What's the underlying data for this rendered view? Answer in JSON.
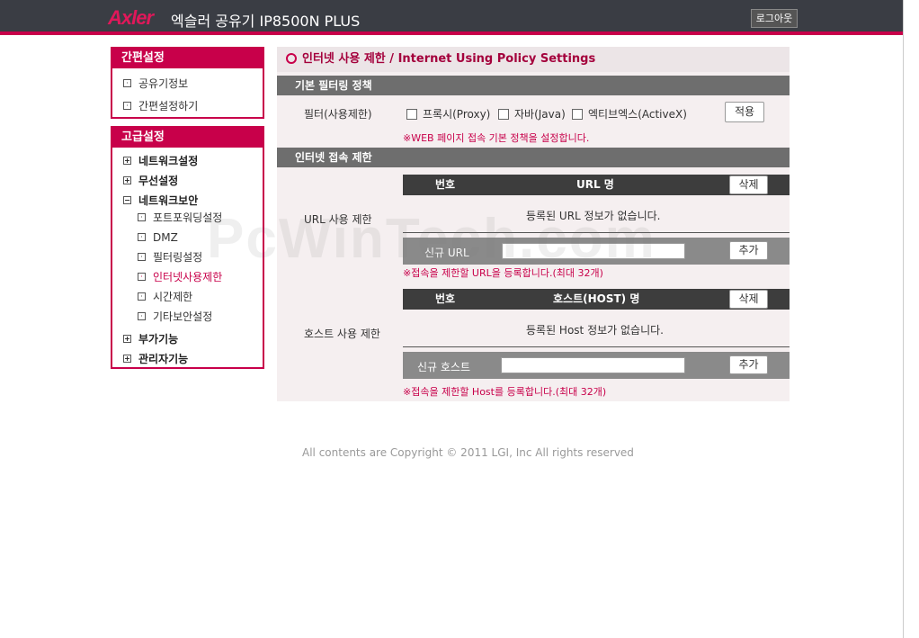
{
  "header": {
    "brand": "Axler",
    "product": "엑슬러 공유기 IP8500N PLUS",
    "logout_label": "로그아웃"
  },
  "simple_menu": {
    "title": "간편설정",
    "items": [
      "공유기정보",
      "간편설정하기"
    ]
  },
  "advanced_menu": {
    "title": "고급설정",
    "groups": [
      {
        "label": "네트워크설정",
        "expanded": false
      },
      {
        "label": "무선설정",
        "expanded": false
      },
      {
        "label": "네트워크보안",
        "expanded": true,
        "children": [
          "포트포워딩설정",
          "DMZ",
          "필터링설정",
          "인터넷사용제한",
          "시간제한",
          "기타보안설정"
        ],
        "active": "인터넷사용제한"
      },
      {
        "label": "부가기능",
        "expanded": false
      },
      {
        "label": "관리자기능",
        "expanded": false
      }
    ]
  },
  "page": {
    "title": "인터넷 사용 제한 / Internet Using Policy Settings",
    "basic_section": "기본 필터링 정책",
    "filter_label": "필터(사용제한)",
    "filters": [
      "프록시(Proxy)",
      "자바(Java)",
      "엑티브엑스(ActiveX)"
    ],
    "apply_button": "적용",
    "basic_note": "※WEB 페이지 접속 기본 정책을 설정합니다.",
    "access_section": "인터넷 접속 제한",
    "url": {
      "label": "URL 사용 제한",
      "col_no": "번호",
      "col_name": "URL 명",
      "delete_button": "삭제",
      "empty_text": "등록된 URL 정보가 없습니다.",
      "new_label": "신규 URL",
      "new_value": "",
      "add_button": "추가",
      "note": "※접속을 제한할 URL을 등록합니다.(최대 32개)"
    },
    "host": {
      "label": "호스트 사용 제한",
      "col_no": "번호",
      "col_name": "호스트(HOST) 명",
      "delete_button": "삭제",
      "empty_text": "등록된 Host 정보가 없습니다.",
      "new_label": "신규 호스트",
      "new_value": "",
      "add_button": "추가",
      "note": "※접속을 제한할 Host를 등록합니다.(최대 32개)"
    }
  },
  "footer": {
    "copyright": "All contents are Copyright © 2011 LGI, Inc All rights reserved"
  },
  "watermark": "PcWinTech.com",
  "colors": {
    "accent": "#c8004a",
    "header_bg": "#3a3d44",
    "section_bg": "#6e6e6e"
  }
}
